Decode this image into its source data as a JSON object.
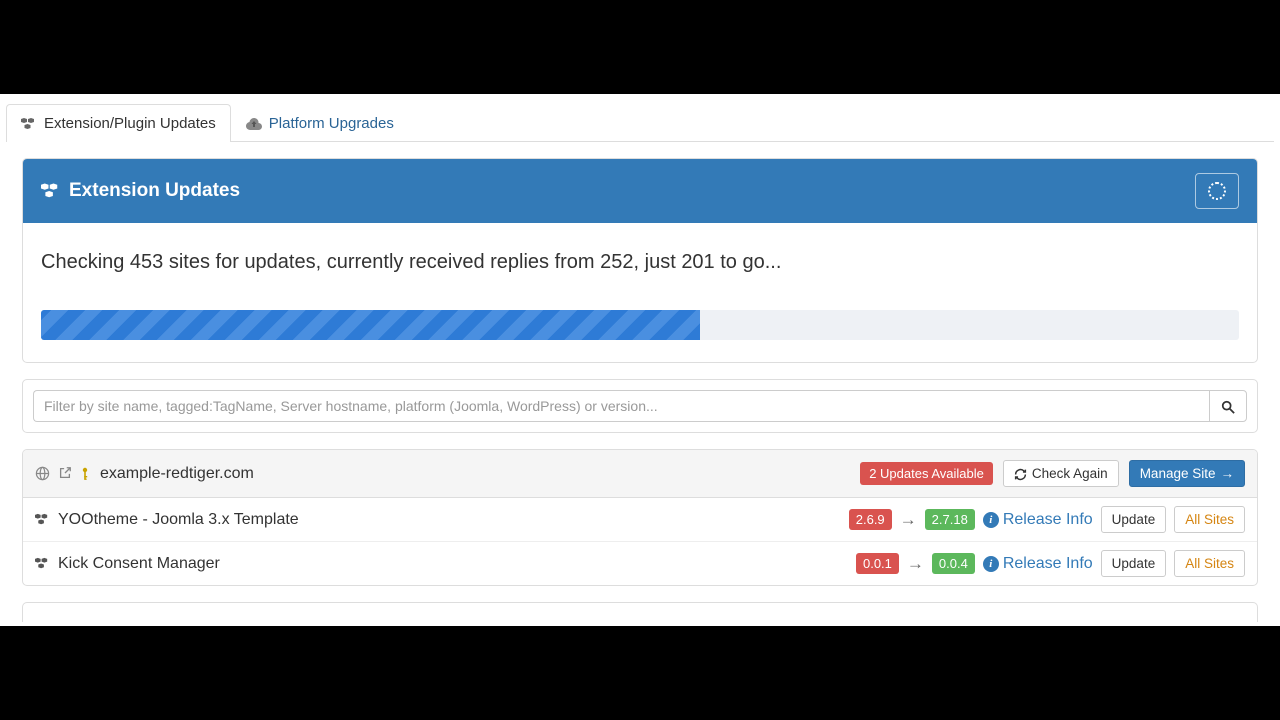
{
  "tabs": {
    "extension_updates": "Extension/Plugin Updates",
    "platform_upgrades": "Platform Upgrades"
  },
  "panel": {
    "title": "Extension Updates",
    "status_text": "Checking 453 sites for updates, currently received replies from 252, just 201 to go...",
    "progress_percent": 55
  },
  "filter": {
    "placeholder": "Filter by site name, tagged:TagName, Server hostname, platform (Joomla, WordPress) or version..."
  },
  "site": {
    "name": "example-redtiger.com",
    "updates_badge": "2 Updates Available",
    "check_again": "Check Again",
    "manage_site": "Manage Site"
  },
  "extensions": [
    {
      "name": "YOOtheme - Joomla 3.x Template",
      "from": "2.6.9",
      "to": "2.7.18",
      "release_info": "Release Info",
      "update": "Update",
      "all_sites": "All Sites"
    },
    {
      "name": "Kick Consent Manager",
      "from": "0.0.1",
      "to": "0.0.4",
      "release_info": "Release Info",
      "update": "Update",
      "all_sites": "All Sites"
    }
  ]
}
